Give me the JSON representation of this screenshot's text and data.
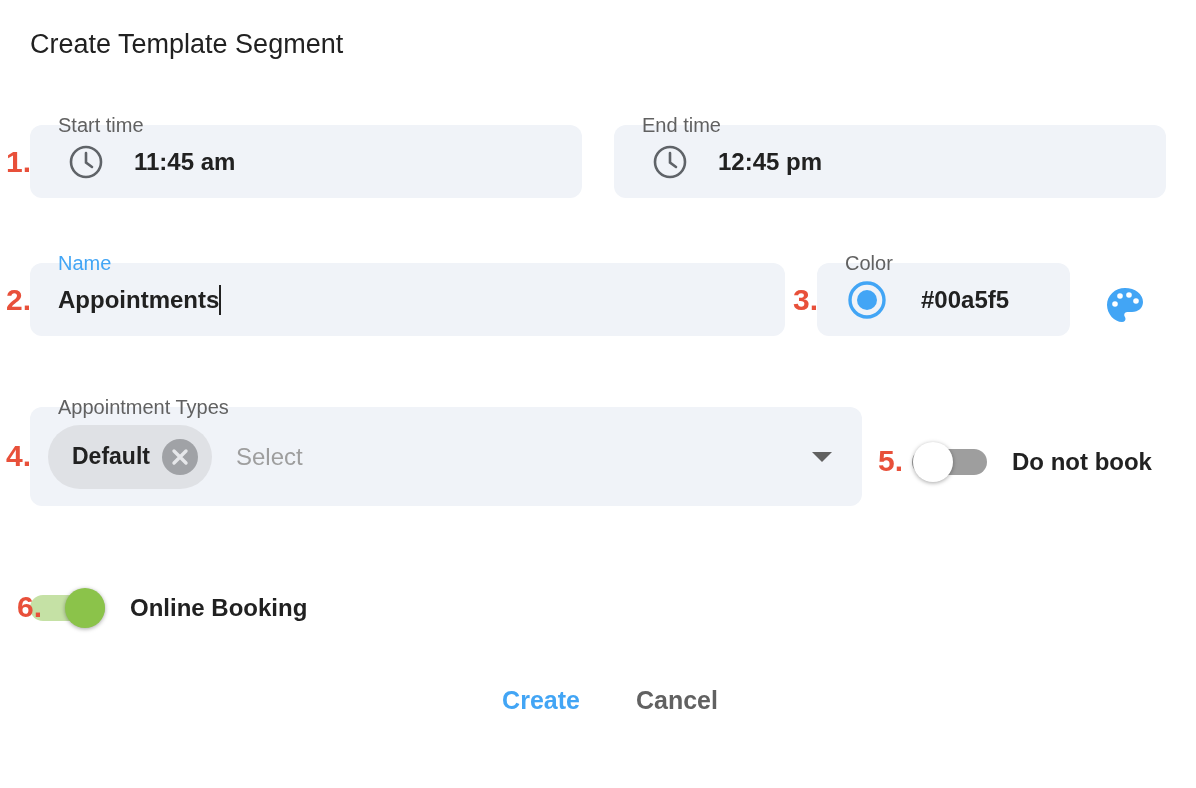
{
  "dialog_title": "Create Template Segment",
  "start_time": {
    "marker": "1.",
    "label": "Start time",
    "value": "11:45 am"
  },
  "end_time": {
    "label": "End time",
    "value": "12:45 pm"
  },
  "name": {
    "marker": "2.",
    "label": "Name",
    "value": "Appointments",
    "focused": true
  },
  "color": {
    "marker": "3.",
    "label": "Color",
    "value": "#00a5f5"
  },
  "appointment_types": {
    "marker": "4.",
    "label": "Appointment Types",
    "chips": [
      "Default"
    ],
    "placeholder": "Select"
  },
  "do_not_book": {
    "marker": "5.",
    "label": "Do not book",
    "on": false
  },
  "online_booking": {
    "marker": "6.",
    "label": "Online Booking",
    "on": true
  },
  "buttons": [
    {
      "label": "Create",
      "kind": "primary"
    },
    {
      "label": "Cancel",
      "kind": "secondary"
    }
  ]
}
